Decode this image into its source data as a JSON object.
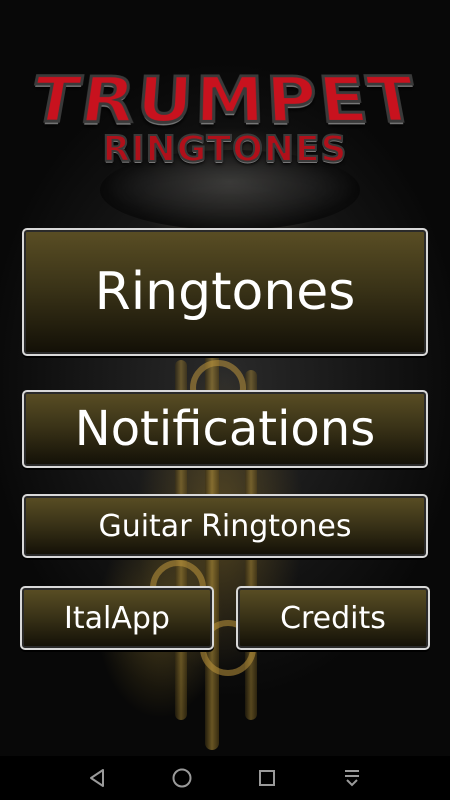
{
  "app": {
    "logo_title": "TRUMPET",
    "logo_subtitle": "RINGTONES"
  },
  "menu": {
    "ringtones_label": "Ringtones",
    "notifications_label": "Notifications",
    "guitar_ringtones_label": "Guitar Ringtones",
    "italapp_label": "ItalApp",
    "credits_label": "Credits"
  },
  "navbar": {
    "icons": [
      "back-icon",
      "home-icon",
      "recents-icon",
      "notification-drawer-icon"
    ]
  },
  "colors": {
    "logo_red": "#c8121e",
    "button_gold_dark": "#3b3418",
    "button_border": "#d8d8d8"
  }
}
